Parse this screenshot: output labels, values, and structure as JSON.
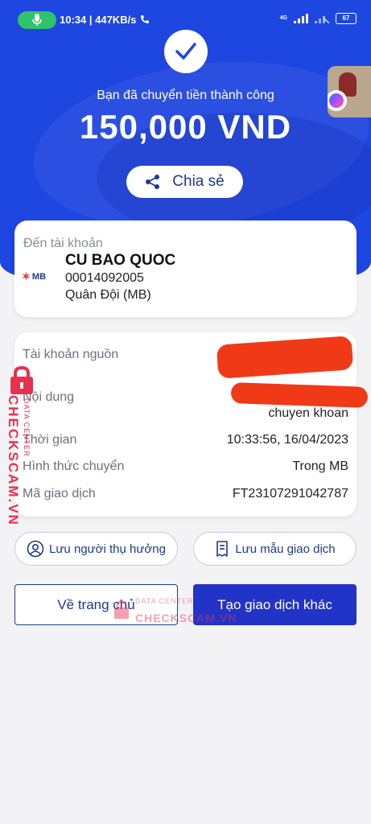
{
  "status_bar": {
    "time_speed": "10:34 | 447KB/s",
    "network": "4G",
    "battery": "67"
  },
  "result": {
    "message": "Bạn đã chuyển tiền thành công",
    "amount": "150,000 VND",
    "share_label": "Chia sẻ"
  },
  "recipient": {
    "label": "Đến tài khoản",
    "bank_logo": "MB",
    "name": "CU BAO QUOC",
    "account_number": "00014092005",
    "bank_name": "Quân Đội (MB)"
  },
  "details": {
    "source_label": "Tài khoản nguồn",
    "content_label": "Nội dung",
    "content_value": "chuyen khoan",
    "time_label": "Thời gian",
    "time_value": "10:33:56, 16/04/2023",
    "method_label": "Hình thức chuyển",
    "method_value": "Trong MB",
    "txn_label": "Mã giao dịch",
    "txn_value": "FT23107291042787"
  },
  "actions": {
    "save_beneficiary": "Lưu người thụ hưởng",
    "save_template": "Lưu mẫu giao dịch",
    "home": "Về trang chủ",
    "new_transaction": "Tạo giao dịch khác"
  },
  "watermark": {
    "main": "CHECKSCAM.VN",
    "sub": "DATA CENTER"
  },
  "colors": {
    "primary": "#1e46e0",
    "button_dark": "#2233c8",
    "redaction": "#f03a17",
    "watermark": "#e8304f"
  }
}
